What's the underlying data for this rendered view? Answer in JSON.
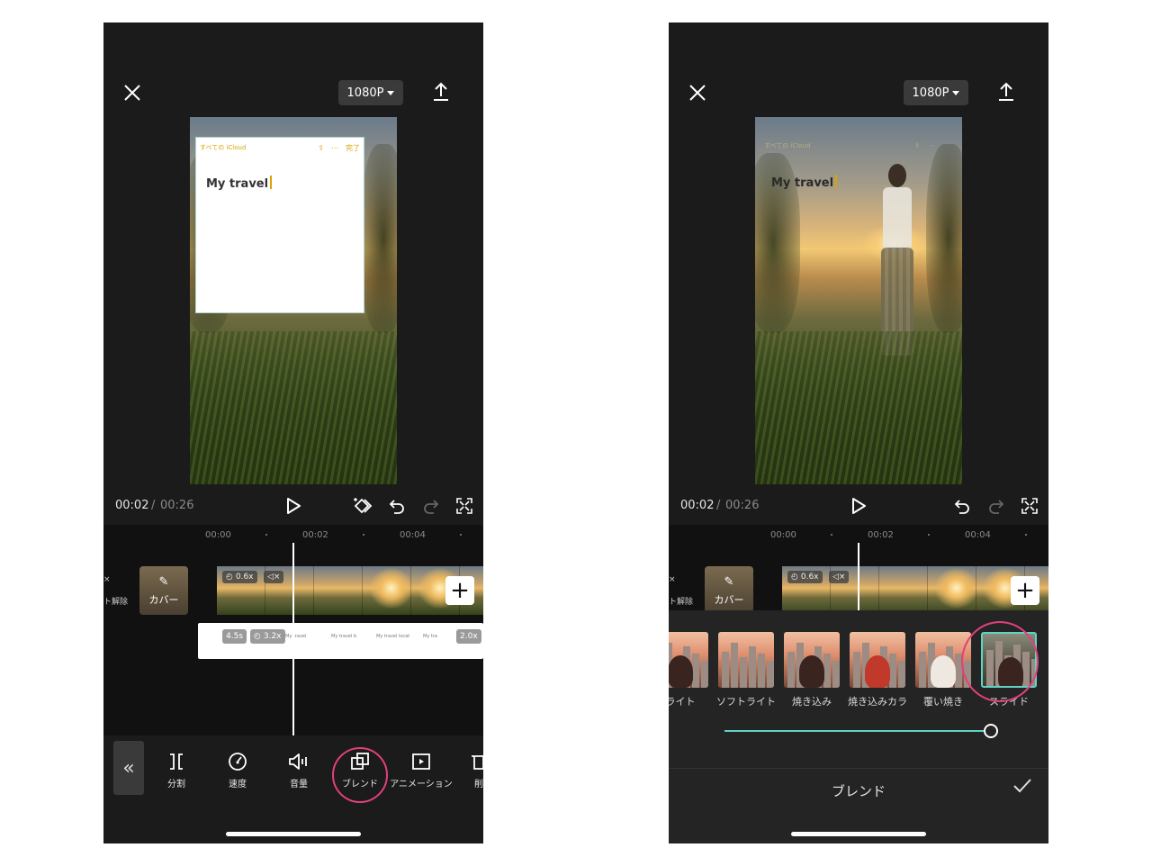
{
  "left": {
    "resolution_label": "1080P",
    "notes_overlay": {
      "back_label": "すべての iCloud",
      "done_label": "完了",
      "body_text": "My travel"
    },
    "time_current": "00:02",
    "time_separator": "/",
    "time_total": "00:26",
    "ruler_labels": [
      "00:00",
      "00:02",
      "00:04"
    ],
    "side_label_top": "×",
    "side_label_bottom": "ト解除",
    "cover_label": "カバー",
    "clip_speed_badge": "0.6x",
    "overlay_badges": [
      "4.5s",
      "3.2x",
      "2.0x"
    ],
    "overlay_texts": [
      "My travel",
      "My travel b",
      "My travel locat",
      "My tra"
    ],
    "tools": [
      {
        "name": "split",
        "label": "分割"
      },
      {
        "name": "speed",
        "label": "速度"
      },
      {
        "name": "volume",
        "label": "音量"
      },
      {
        "name": "blend",
        "label": "ブレンド"
      },
      {
        "name": "animation",
        "label": "アニメーション"
      },
      {
        "name": "delete",
        "label": "削"
      }
    ]
  },
  "right": {
    "resolution_label": "1080P",
    "ghost_back_label": "すべての iCloud",
    "body_text": "My travel",
    "time_current": "00:02",
    "time_separator": "/",
    "time_total": "00:26",
    "ruler_labels": [
      "00:00",
      "00:02",
      "00:04"
    ],
    "side_label_top": "×",
    "side_label_bottom": "ト解除",
    "cover_label": "カバー",
    "clip_speed_badge": "0.6x",
    "blend_modes": [
      {
        "label": "ライト",
        "style": "brown"
      },
      {
        "label": "ソフトライト",
        "style": "plain"
      },
      {
        "label": "焼き込み",
        "style": "brown"
      },
      {
        "label": "焼き込みカラ",
        "style": "red"
      },
      {
        "label": "覆い焼き",
        "style": "white"
      },
      {
        "label": "スライド",
        "style": "dark",
        "selected": true
      }
    ],
    "slider_value": 1.0,
    "panel_title": "ブレンド"
  },
  "colors": {
    "accent_teal": "#5fd3c4",
    "highlight_circle": "#e0407e",
    "notes_yellow": "#d9a400",
    "app_background": "#1b1b1b"
  }
}
